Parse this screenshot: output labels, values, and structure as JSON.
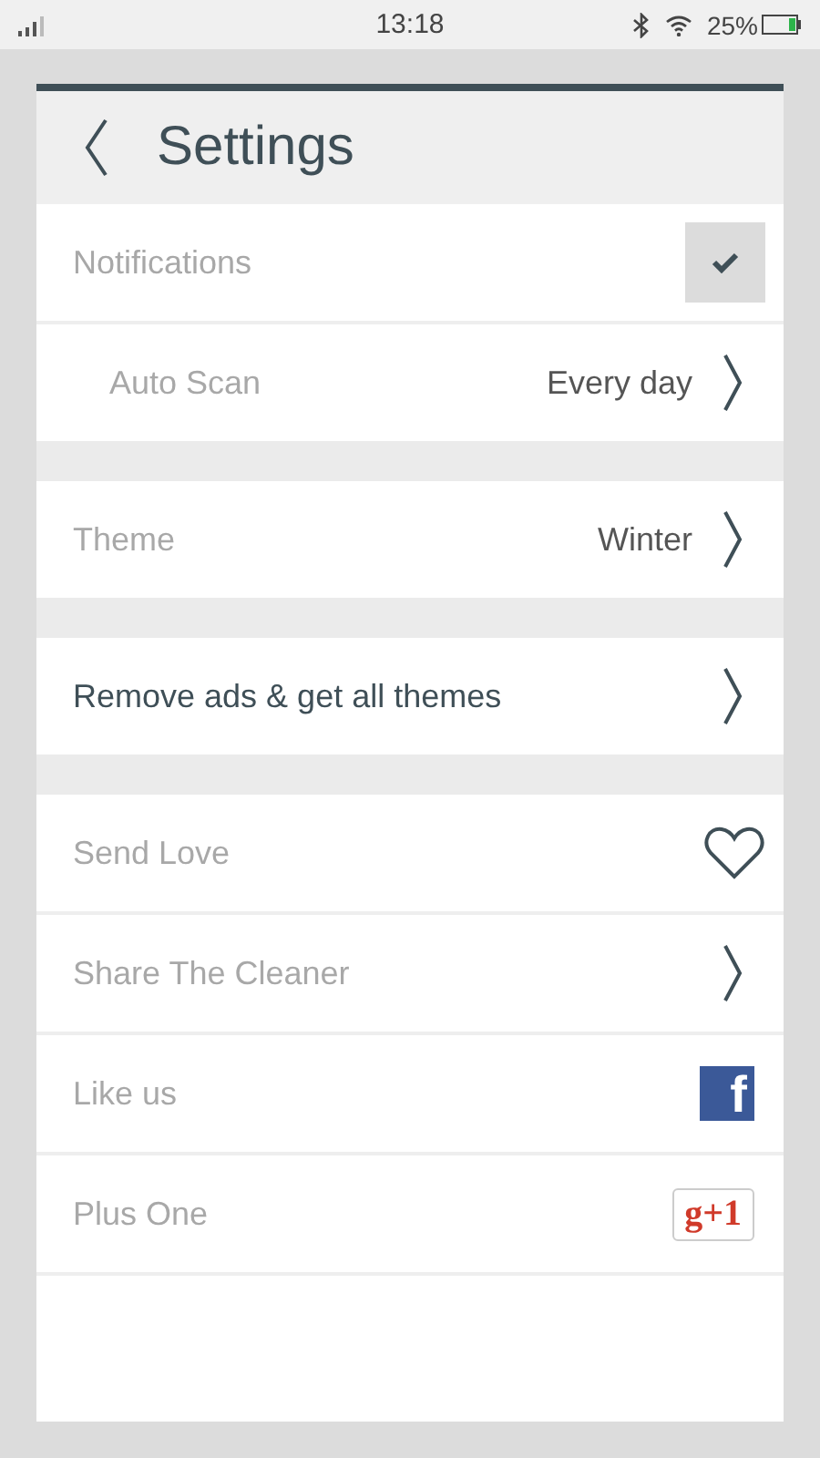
{
  "status_bar": {
    "time": "13:18",
    "battery": "25%"
  },
  "header": {
    "title": "Settings"
  },
  "sections": [
    {
      "rows": [
        {
          "kind": "checkbox",
          "label": "Notifications",
          "indented": false,
          "emphasis": false,
          "checked": true
        },
        {
          "kind": "value",
          "label": "Auto Scan",
          "indented": true,
          "emphasis": false,
          "value": "Every day"
        }
      ]
    },
    {
      "rows": [
        {
          "kind": "value",
          "label": "Theme",
          "indented": false,
          "emphasis": false,
          "value": "Winter"
        }
      ]
    },
    {
      "rows": [
        {
          "kind": "link",
          "label": "Remove ads & get all themes",
          "indented": false,
          "emphasis": true
        }
      ]
    },
    {
      "rows": [
        {
          "kind": "heart",
          "label": "Send Love",
          "indented": false,
          "emphasis": false
        },
        {
          "kind": "link",
          "label": "Share The Cleaner",
          "indented": false,
          "emphasis": false
        },
        {
          "kind": "facebook",
          "label": "Like us",
          "indented": false,
          "emphasis": false,
          "badge": "f"
        },
        {
          "kind": "gplus",
          "label": "Plus One",
          "indented": false,
          "emphasis": false,
          "badge": "g+1"
        }
      ]
    }
  ]
}
